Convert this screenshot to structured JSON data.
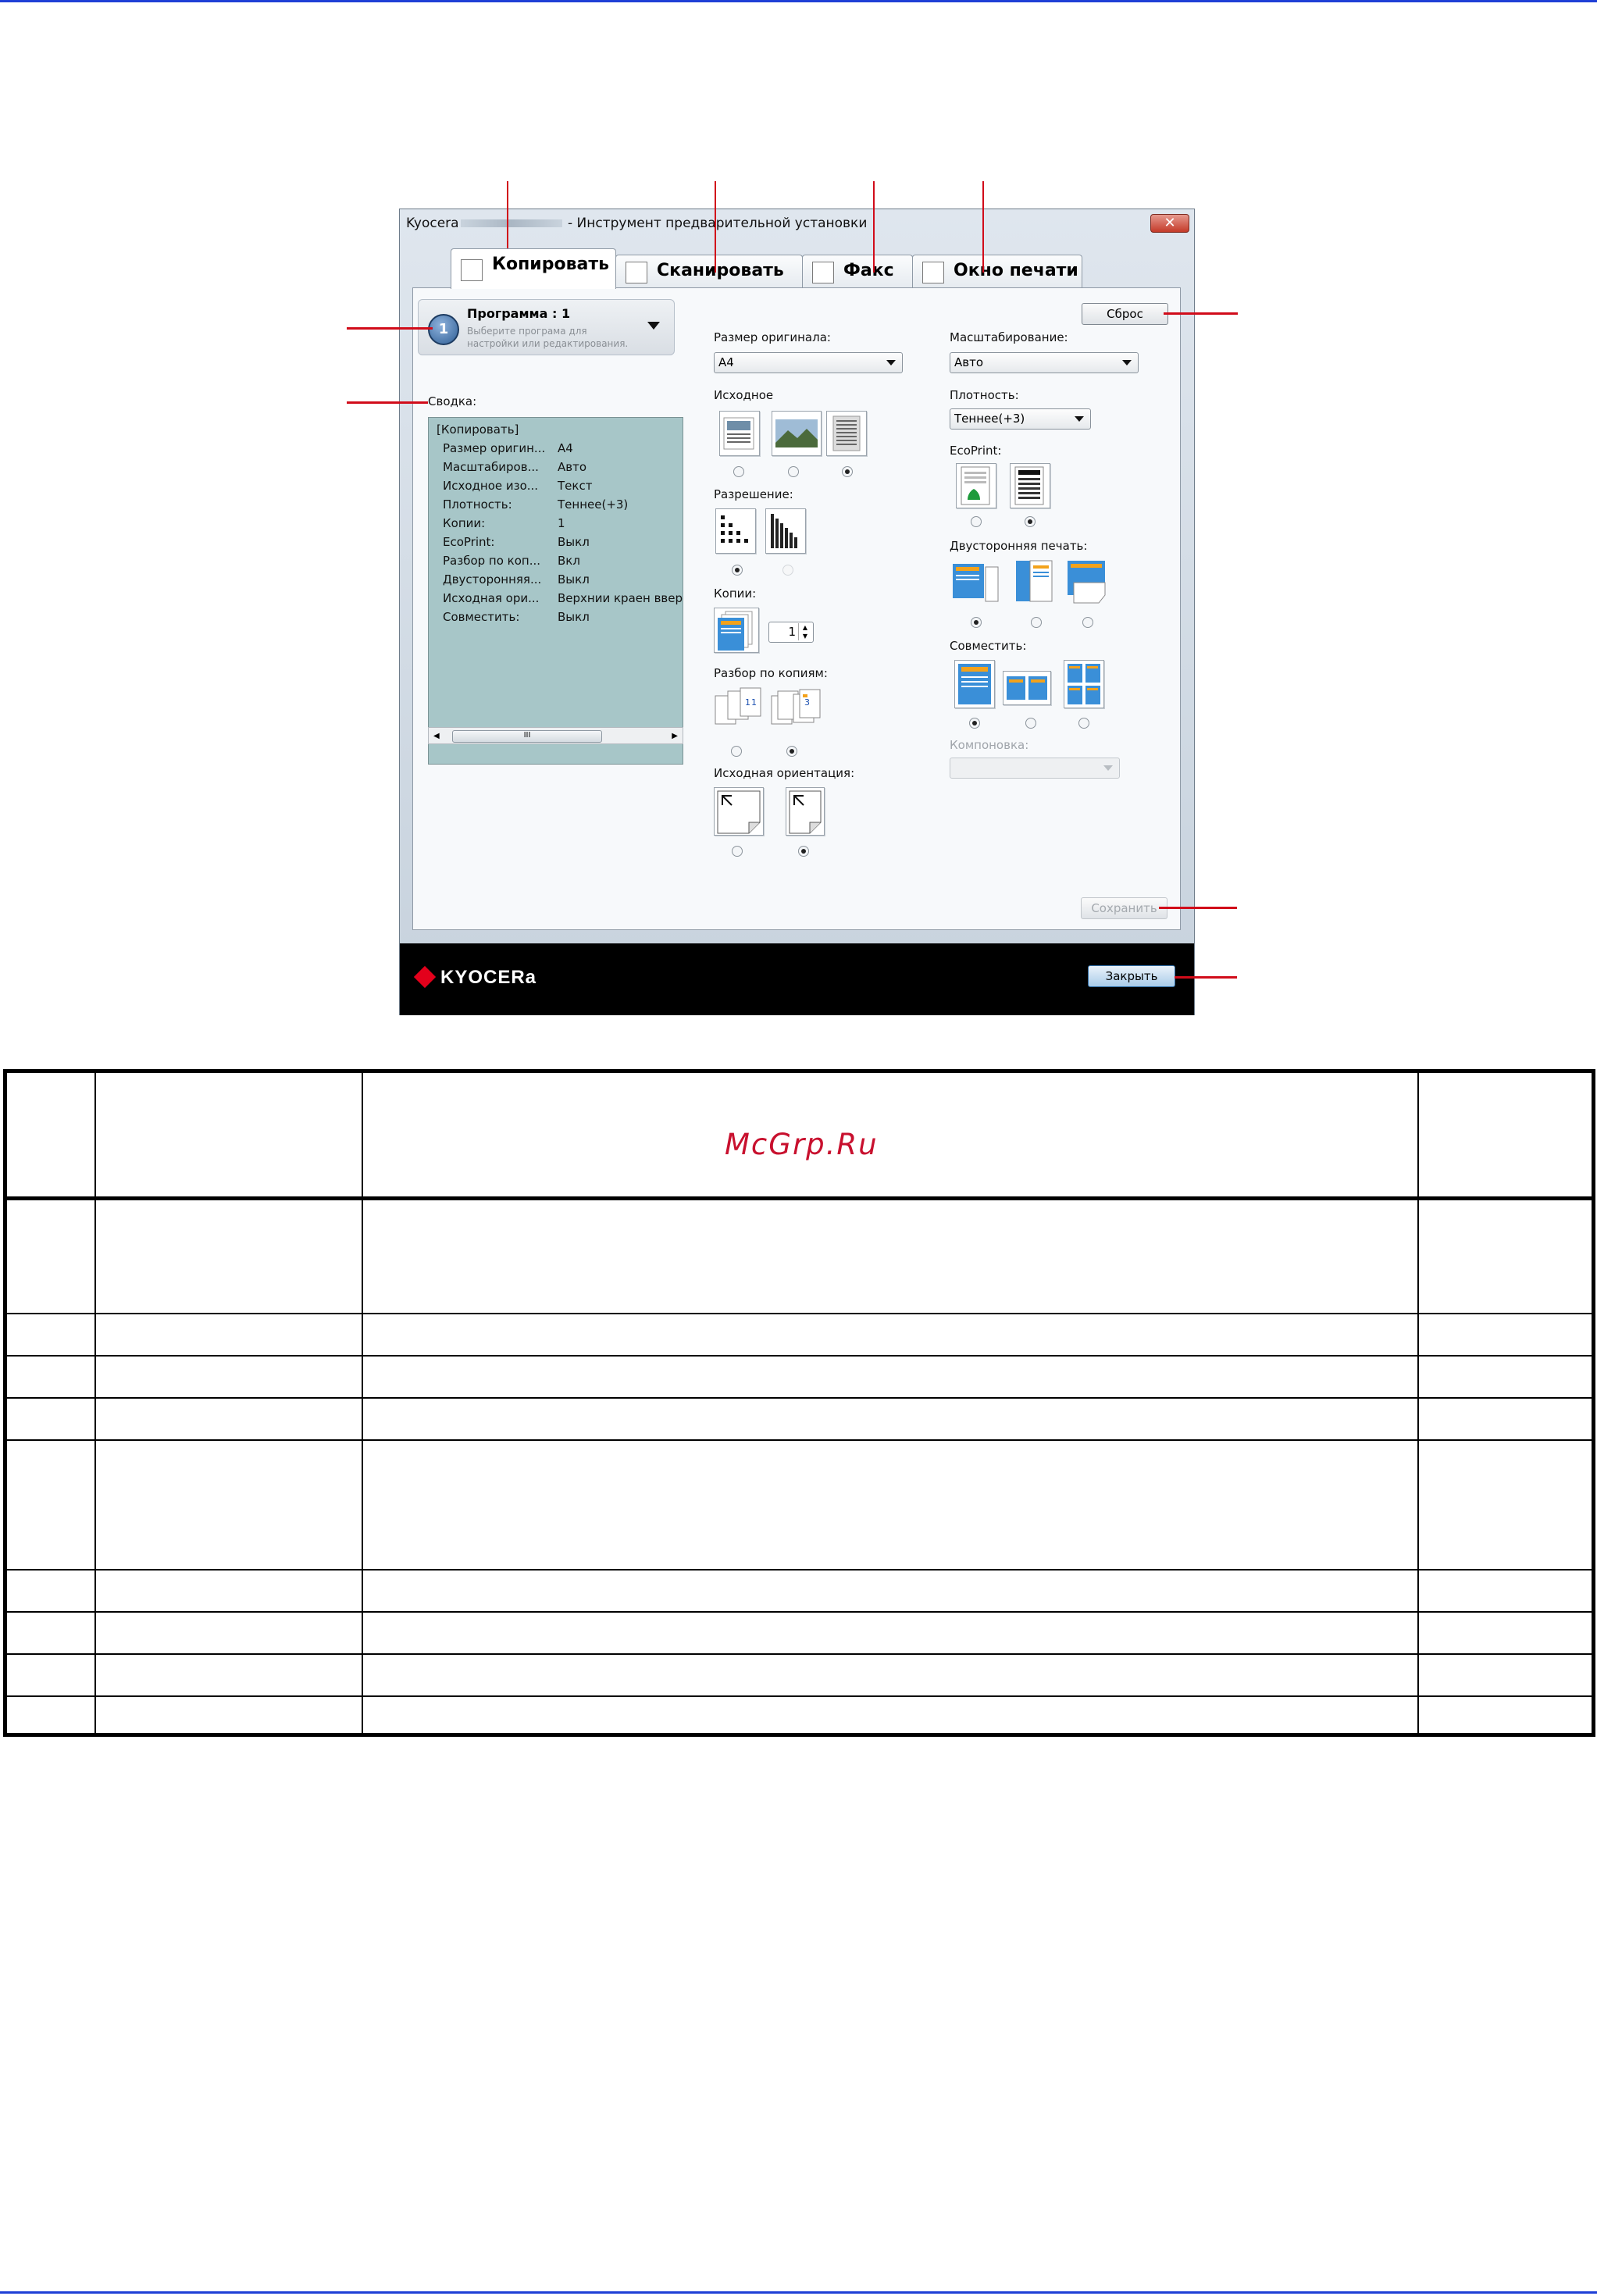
{
  "window": {
    "title_prefix": "Kyocera",
    "title_suffix": " - Инструмент предварительной установки",
    "close_glyph": "✕",
    "tabs": [
      {
        "label": "Копировать"
      },
      {
        "label": "Сканировать"
      },
      {
        "label": "Факс"
      },
      {
        "label": "Окно печати"
      }
    ],
    "program": {
      "number": "1",
      "title": "Программа : 1",
      "hint": "Выберите програма для настройки или редактирования."
    },
    "reset_label": "Сброс",
    "summary": {
      "label": "Сводка:",
      "header": "[Копировать]",
      "rows": [
        {
          "name": "Размер оригин...",
          "value": "A4"
        },
        {
          "name": "Масштабиров...",
          "value": "Авто"
        },
        {
          "name": "Исходное изо...",
          "value": "Текст"
        },
        {
          "name": "Плотность:",
          "value": "Теннее(+3)"
        },
        {
          "name": "Копии:",
          "value": "1"
        },
        {
          "name": "EcoPrint:",
          "value": "Выкл"
        },
        {
          "name": "Разбор по коп...",
          "value": "Вкл"
        },
        {
          "name": "Двусторонняя...",
          "value": "Выкл"
        },
        {
          "name": "Исходная ори...",
          "value": "Верхнии краен вверх"
        },
        {
          "name": "Совместить:",
          "value": "Выкл"
        }
      ],
      "scroll_thumb": "III"
    },
    "middle": {
      "original_size_label": "Размер оригинала:",
      "original_size_value": "A4",
      "source_label": "Исходное",
      "resolution_label": "Разрешение:",
      "copies_label": "Копии:",
      "copies_value": "1",
      "collate_label": "Разбор по копиям:",
      "orientation_label": "Исходная ориентация:"
    },
    "right": {
      "scaling_label": "Масштабирование:",
      "scaling_value": "Авто",
      "density_label": "Плотность:",
      "density_value": "Теннее(+3)",
      "ecoprint_label": "EcoPrint:",
      "duplex_label": "Двусторонняя печать:",
      "combine_label": "Совместить:",
      "layout_label": "Компоновка:",
      "layout_value": ""
    },
    "save_label": "Сохранить",
    "close_label": "Закрыть",
    "logo_text": "KYOCERa"
  },
  "watermark": "McGrp.Ru",
  "colors": {
    "page_rule": "#1f3fd6",
    "callout": "#d10c1a",
    "summary_bg": "#a7c6c8",
    "footer_bg": "#000000"
  }
}
